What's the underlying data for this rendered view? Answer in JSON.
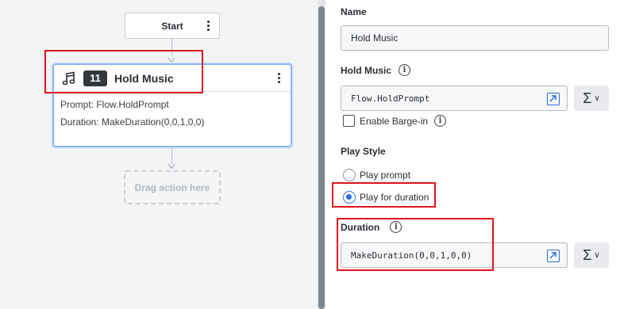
{
  "canvas": {
    "start_node": {
      "label": "Start"
    },
    "action_node": {
      "step_number": "11",
      "title": "Hold Music",
      "prompt_line": "Prompt: Flow.HoldPrompt",
      "duration_line": "Duration: MakeDuration(0,0,1,0,0)"
    },
    "drag_placeholder": "Drag action here"
  },
  "panel": {
    "name": {
      "label": "Name",
      "value": "Hold Music"
    },
    "hold_music": {
      "label": "Hold Music",
      "value": "Flow.HoldPrompt"
    },
    "barge_in": {
      "label": "Enable Barge-in",
      "checked": false
    },
    "play_style": {
      "label": "Play Style",
      "options": [
        {
          "label": "Play prompt",
          "selected": false
        },
        {
          "label": "Play for duration",
          "selected": true
        }
      ]
    },
    "duration": {
      "label": "Duration",
      "value": "MakeDuration(0,0,1,0,0)"
    }
  },
  "icons": {
    "music": "music-note-icon",
    "info": "info-icon",
    "expand": "expand-icon",
    "sigma": "sigma-icon"
  },
  "colors": {
    "accent_blue": "#2a6fd6",
    "highlight_red": "#e0141b",
    "node_selected_border": "#8ab4f8",
    "badge_bg": "#33383d"
  }
}
